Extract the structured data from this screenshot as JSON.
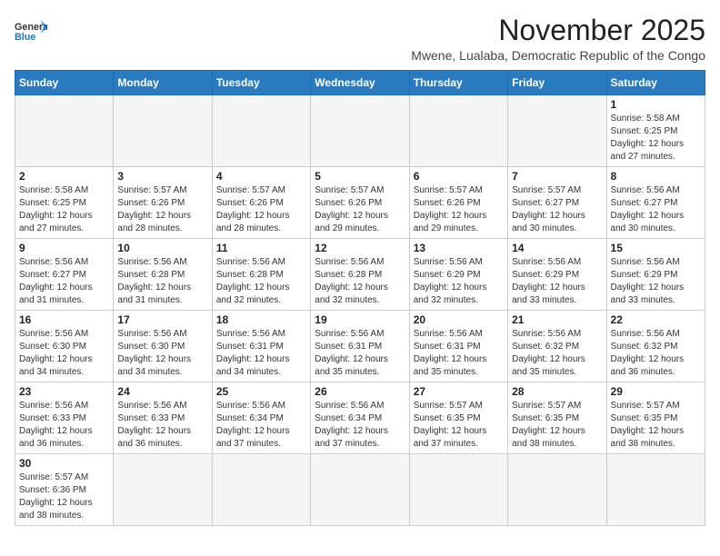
{
  "header": {
    "logo_general": "General",
    "logo_blue": "Blue",
    "month": "November 2025",
    "location": "Mwene, Lualaba, Democratic Republic of the Congo"
  },
  "days_of_week": [
    "Sunday",
    "Monday",
    "Tuesday",
    "Wednesday",
    "Thursday",
    "Friday",
    "Saturday"
  ],
  "weeks": [
    [
      {
        "day": "",
        "info": ""
      },
      {
        "day": "",
        "info": ""
      },
      {
        "day": "",
        "info": ""
      },
      {
        "day": "",
        "info": ""
      },
      {
        "day": "",
        "info": ""
      },
      {
        "day": "",
        "info": ""
      },
      {
        "day": "1",
        "info": "Sunrise: 5:58 AM\nSunset: 6:25 PM\nDaylight: 12 hours and 27 minutes."
      }
    ],
    [
      {
        "day": "2",
        "info": "Sunrise: 5:58 AM\nSunset: 6:25 PM\nDaylight: 12 hours and 27 minutes."
      },
      {
        "day": "3",
        "info": "Sunrise: 5:57 AM\nSunset: 6:26 PM\nDaylight: 12 hours and 28 minutes."
      },
      {
        "day": "4",
        "info": "Sunrise: 5:57 AM\nSunset: 6:26 PM\nDaylight: 12 hours and 28 minutes."
      },
      {
        "day": "5",
        "info": "Sunrise: 5:57 AM\nSunset: 6:26 PM\nDaylight: 12 hours and 29 minutes."
      },
      {
        "day": "6",
        "info": "Sunrise: 5:57 AM\nSunset: 6:26 PM\nDaylight: 12 hours and 29 minutes."
      },
      {
        "day": "7",
        "info": "Sunrise: 5:57 AM\nSunset: 6:27 PM\nDaylight: 12 hours and 30 minutes."
      },
      {
        "day": "8",
        "info": "Sunrise: 5:56 AM\nSunset: 6:27 PM\nDaylight: 12 hours and 30 minutes."
      }
    ],
    [
      {
        "day": "9",
        "info": "Sunrise: 5:56 AM\nSunset: 6:27 PM\nDaylight: 12 hours and 31 minutes."
      },
      {
        "day": "10",
        "info": "Sunrise: 5:56 AM\nSunset: 6:28 PM\nDaylight: 12 hours and 31 minutes."
      },
      {
        "day": "11",
        "info": "Sunrise: 5:56 AM\nSunset: 6:28 PM\nDaylight: 12 hours and 32 minutes."
      },
      {
        "day": "12",
        "info": "Sunrise: 5:56 AM\nSunset: 6:28 PM\nDaylight: 12 hours and 32 minutes."
      },
      {
        "day": "13",
        "info": "Sunrise: 5:56 AM\nSunset: 6:29 PM\nDaylight: 12 hours and 32 minutes."
      },
      {
        "day": "14",
        "info": "Sunrise: 5:56 AM\nSunset: 6:29 PM\nDaylight: 12 hours and 33 minutes."
      },
      {
        "day": "15",
        "info": "Sunrise: 5:56 AM\nSunset: 6:29 PM\nDaylight: 12 hours and 33 minutes."
      }
    ],
    [
      {
        "day": "16",
        "info": "Sunrise: 5:56 AM\nSunset: 6:30 PM\nDaylight: 12 hours and 34 minutes."
      },
      {
        "day": "17",
        "info": "Sunrise: 5:56 AM\nSunset: 6:30 PM\nDaylight: 12 hours and 34 minutes."
      },
      {
        "day": "18",
        "info": "Sunrise: 5:56 AM\nSunset: 6:31 PM\nDaylight: 12 hours and 34 minutes."
      },
      {
        "day": "19",
        "info": "Sunrise: 5:56 AM\nSunset: 6:31 PM\nDaylight: 12 hours and 35 minutes."
      },
      {
        "day": "20",
        "info": "Sunrise: 5:56 AM\nSunset: 6:31 PM\nDaylight: 12 hours and 35 minutes."
      },
      {
        "day": "21",
        "info": "Sunrise: 5:56 AM\nSunset: 6:32 PM\nDaylight: 12 hours and 35 minutes."
      },
      {
        "day": "22",
        "info": "Sunrise: 5:56 AM\nSunset: 6:32 PM\nDaylight: 12 hours and 36 minutes."
      }
    ],
    [
      {
        "day": "23",
        "info": "Sunrise: 5:56 AM\nSunset: 6:33 PM\nDaylight: 12 hours and 36 minutes."
      },
      {
        "day": "24",
        "info": "Sunrise: 5:56 AM\nSunset: 6:33 PM\nDaylight: 12 hours and 36 minutes."
      },
      {
        "day": "25",
        "info": "Sunrise: 5:56 AM\nSunset: 6:34 PM\nDaylight: 12 hours and 37 minutes."
      },
      {
        "day": "26",
        "info": "Sunrise: 5:56 AM\nSunset: 6:34 PM\nDaylight: 12 hours and 37 minutes."
      },
      {
        "day": "27",
        "info": "Sunrise: 5:57 AM\nSunset: 6:35 PM\nDaylight: 12 hours and 37 minutes."
      },
      {
        "day": "28",
        "info": "Sunrise: 5:57 AM\nSunset: 6:35 PM\nDaylight: 12 hours and 38 minutes."
      },
      {
        "day": "29",
        "info": "Sunrise: 5:57 AM\nSunset: 6:35 PM\nDaylight: 12 hours and 38 minutes."
      }
    ],
    [
      {
        "day": "30",
        "info": "Sunrise: 5:57 AM\nSunset: 6:36 PM\nDaylight: 12 hours and 38 minutes."
      },
      {
        "day": "",
        "info": ""
      },
      {
        "day": "",
        "info": ""
      },
      {
        "day": "",
        "info": ""
      },
      {
        "day": "",
        "info": ""
      },
      {
        "day": "",
        "info": ""
      },
      {
        "day": "",
        "info": ""
      }
    ]
  ]
}
